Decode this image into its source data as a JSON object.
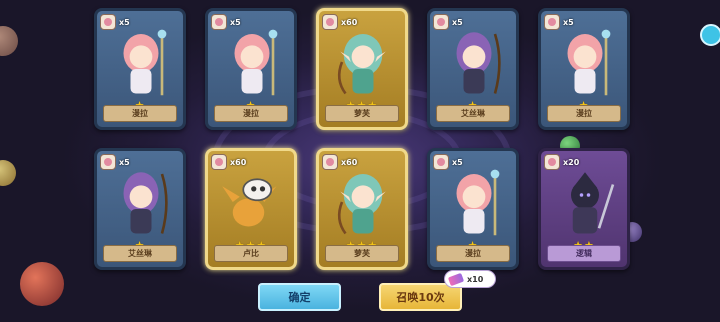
{
  "cards": [
    {
      "count": "x5",
      "name": "漫拉",
      "stars": "★",
      "rarity": "blue",
      "char": "pink-mage"
    },
    {
      "count": "x5",
      "name": "漫拉",
      "stars": "★",
      "rarity": "blue",
      "char": "pink-mage"
    },
    {
      "count": "x60",
      "name": "萝芙",
      "stars": "★★★",
      "rarity": "gold",
      "char": "elf-archer"
    },
    {
      "count": "x5",
      "name": "艾丝琳",
      "stars": "★",
      "rarity": "blue",
      "char": "purple-archer"
    },
    {
      "count": "x5",
      "name": "漫拉",
      "stars": "★",
      "rarity": "blue",
      "char": "pink-mage"
    },
    {
      "count": "x5",
      "name": "艾丝琳",
      "stars": "★",
      "rarity": "blue",
      "char": "purple-archer"
    },
    {
      "count": "x60",
      "name": "卢比",
      "stars": "★★★",
      "rarity": "gold",
      "char": "dragon"
    },
    {
      "count": "x60",
      "name": "萝芙",
      "stars": "★★★",
      "rarity": "gold",
      "char": "elf-archer"
    },
    {
      "count": "x5",
      "name": "漫拉",
      "stars": "★",
      "rarity": "blue",
      "char": "pink-mage"
    },
    {
      "count": "x20",
      "name": "逻辑",
      "stars": "★★",
      "rarity": "purple",
      "char": "shadow-warrior"
    }
  ],
  "buttons": {
    "confirm": "确定",
    "summon": "召唤10次"
  },
  "ticket": {
    "count": "x10",
    "icon": "summon-ticket-icon"
  },
  "colors": {
    "gold_card": "#c9a23f",
    "blue_card": "#4e6f96",
    "purple_card": "#6e4c96",
    "confirm": "#4ab3df",
    "summon": "#e7b638"
  }
}
